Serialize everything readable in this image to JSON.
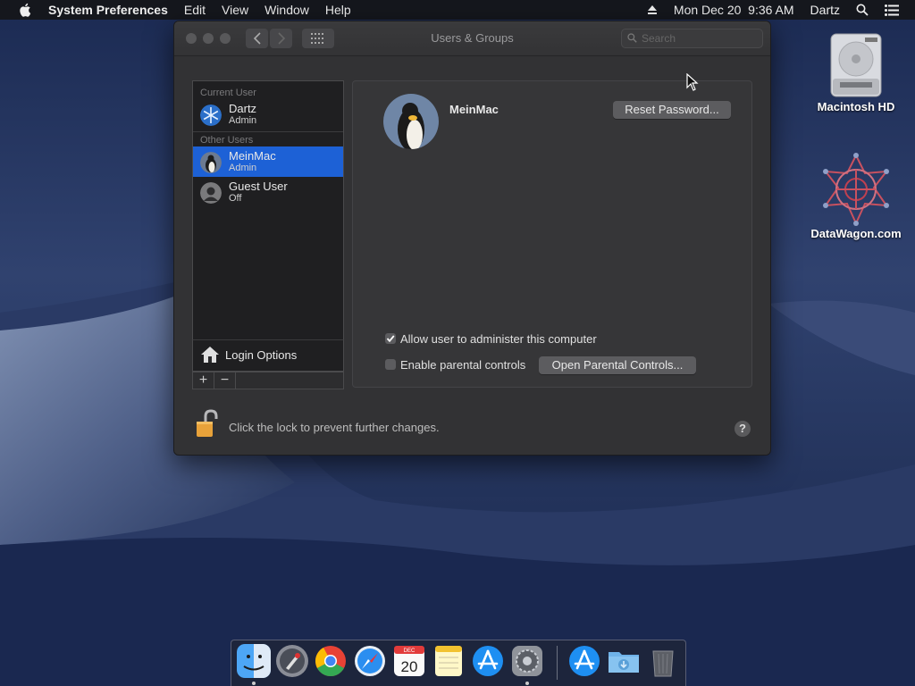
{
  "menubar": {
    "app_name": "System Preferences",
    "menus": [
      "Edit",
      "View",
      "Window",
      "Help"
    ],
    "datetime": "Mon Dec 20  9:36 AM",
    "user": "Dartz",
    "icons": [
      "apple-icon",
      "eject-icon",
      "spotlight-icon",
      "notification-center-icon"
    ]
  },
  "window": {
    "title": "Users & Groups",
    "search_placeholder": "Search"
  },
  "users": {
    "current_header": "Current User",
    "other_header": "Other Users",
    "current": {
      "name": "Dartz",
      "role": "Admin"
    },
    "others": [
      {
        "name": "MeinMac",
        "role": "Admin",
        "selected": true
      },
      {
        "name": "Guest User",
        "role": "Off",
        "selected": false
      }
    ],
    "login_options": "Login Options",
    "add": "+",
    "remove": "−"
  },
  "detail": {
    "username": "MeinMac",
    "reset_password": "Reset Password...",
    "allow_admin": "Allow user to administer this computer",
    "allow_admin_checked": true,
    "parental_controls": "Enable parental controls",
    "parental_controls_checked": false,
    "open_parental": "Open Parental Controls..."
  },
  "footer": {
    "lock_text": "Click the lock to prevent further changes.",
    "help": "?"
  },
  "desktop": {
    "icons": [
      {
        "label": "Macintosh HD"
      },
      {
        "label": "DataWagon.com"
      }
    ]
  },
  "dock": {
    "items": [
      "Finder",
      "Launchpad",
      "Chrome",
      "Safari",
      "Calendar",
      "Notes",
      "App Store",
      "System Preferences",
      "App Store Downloads",
      "Downloads",
      "Trash"
    ],
    "calendar_day": "20",
    "calendar_month": "DEC"
  },
  "colors": {
    "selection": "#1d61d6",
    "window_bg": "#323234",
    "lock": "#e8a23a"
  }
}
